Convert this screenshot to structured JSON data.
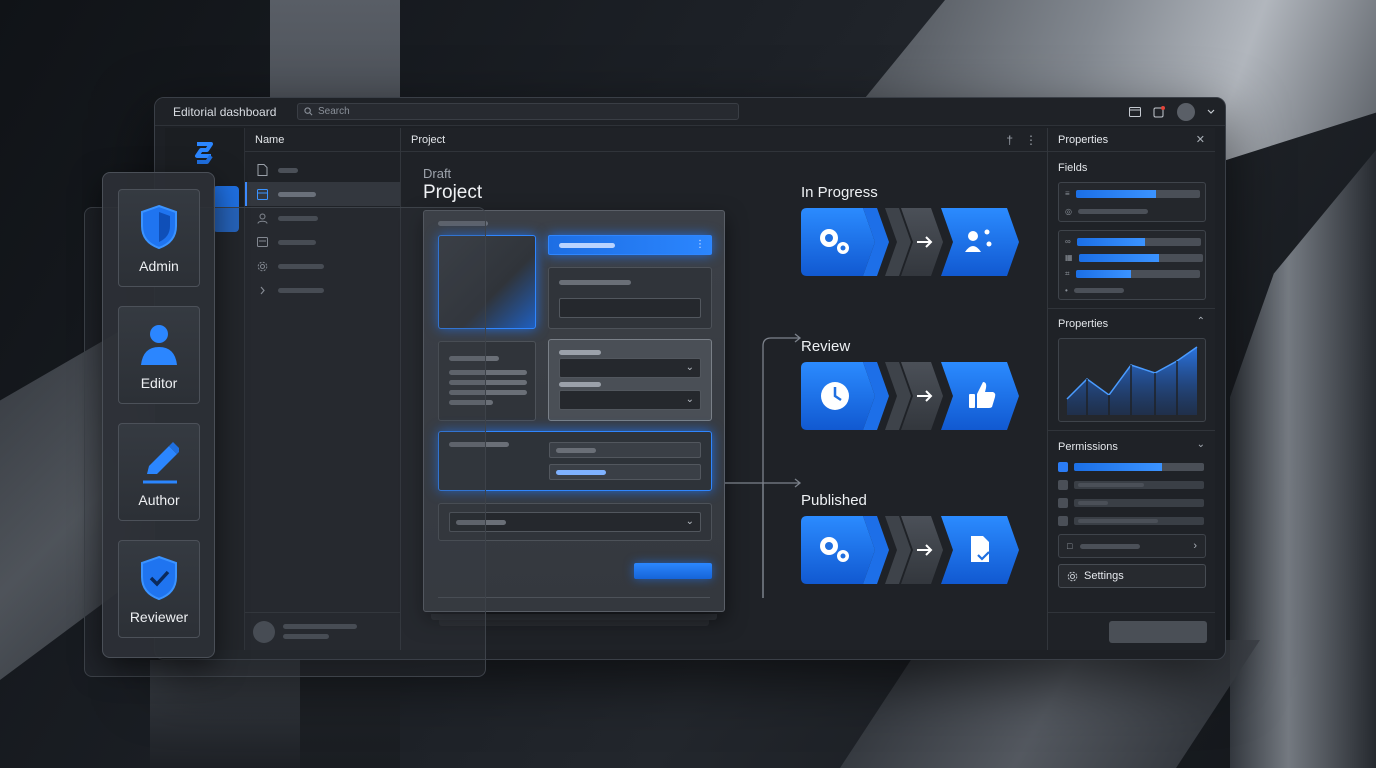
{
  "window": {
    "title": "Editorial dashboard"
  },
  "search": {
    "placeholder": "Search"
  },
  "nav": {
    "header": "Name"
  },
  "center": {
    "header": "Project",
    "status": "Draft",
    "title": "Project"
  },
  "workflow": {
    "stages": [
      {
        "label": "In Progress",
        "start_icon": "gears-icon",
        "end_icon": "user-share-icon"
      },
      {
        "label": "Review",
        "start_icon": "clock-icon",
        "end_icon": "thumbs-up-icon"
      },
      {
        "label": "Published",
        "start_icon": "gears-icon",
        "end_icon": "document-check-icon"
      }
    ]
  },
  "properties_panel": {
    "header": "Properties",
    "fields_title": "Fields",
    "properties_title": "Properties",
    "permissions_title": "Permissions",
    "settings_label": "Settings",
    "field_levels": [
      0.65,
      0.55,
      0.65,
      0.45
    ],
    "permission_checked": [
      true,
      false,
      false,
      false
    ],
    "permission_level": 0.68
  },
  "roles": [
    {
      "label": "Admin",
      "icon": "shield-icon"
    },
    {
      "label": "Editor",
      "icon": "user-icon"
    },
    {
      "label": "Author",
      "icon": "pencil-icon"
    },
    {
      "label": "Reviewer",
      "icon": "shield-check-icon"
    }
  ],
  "colors": {
    "accent": "#1f74f0",
    "accent_light": "#3b93ff",
    "panel": "#1f2227"
  }
}
